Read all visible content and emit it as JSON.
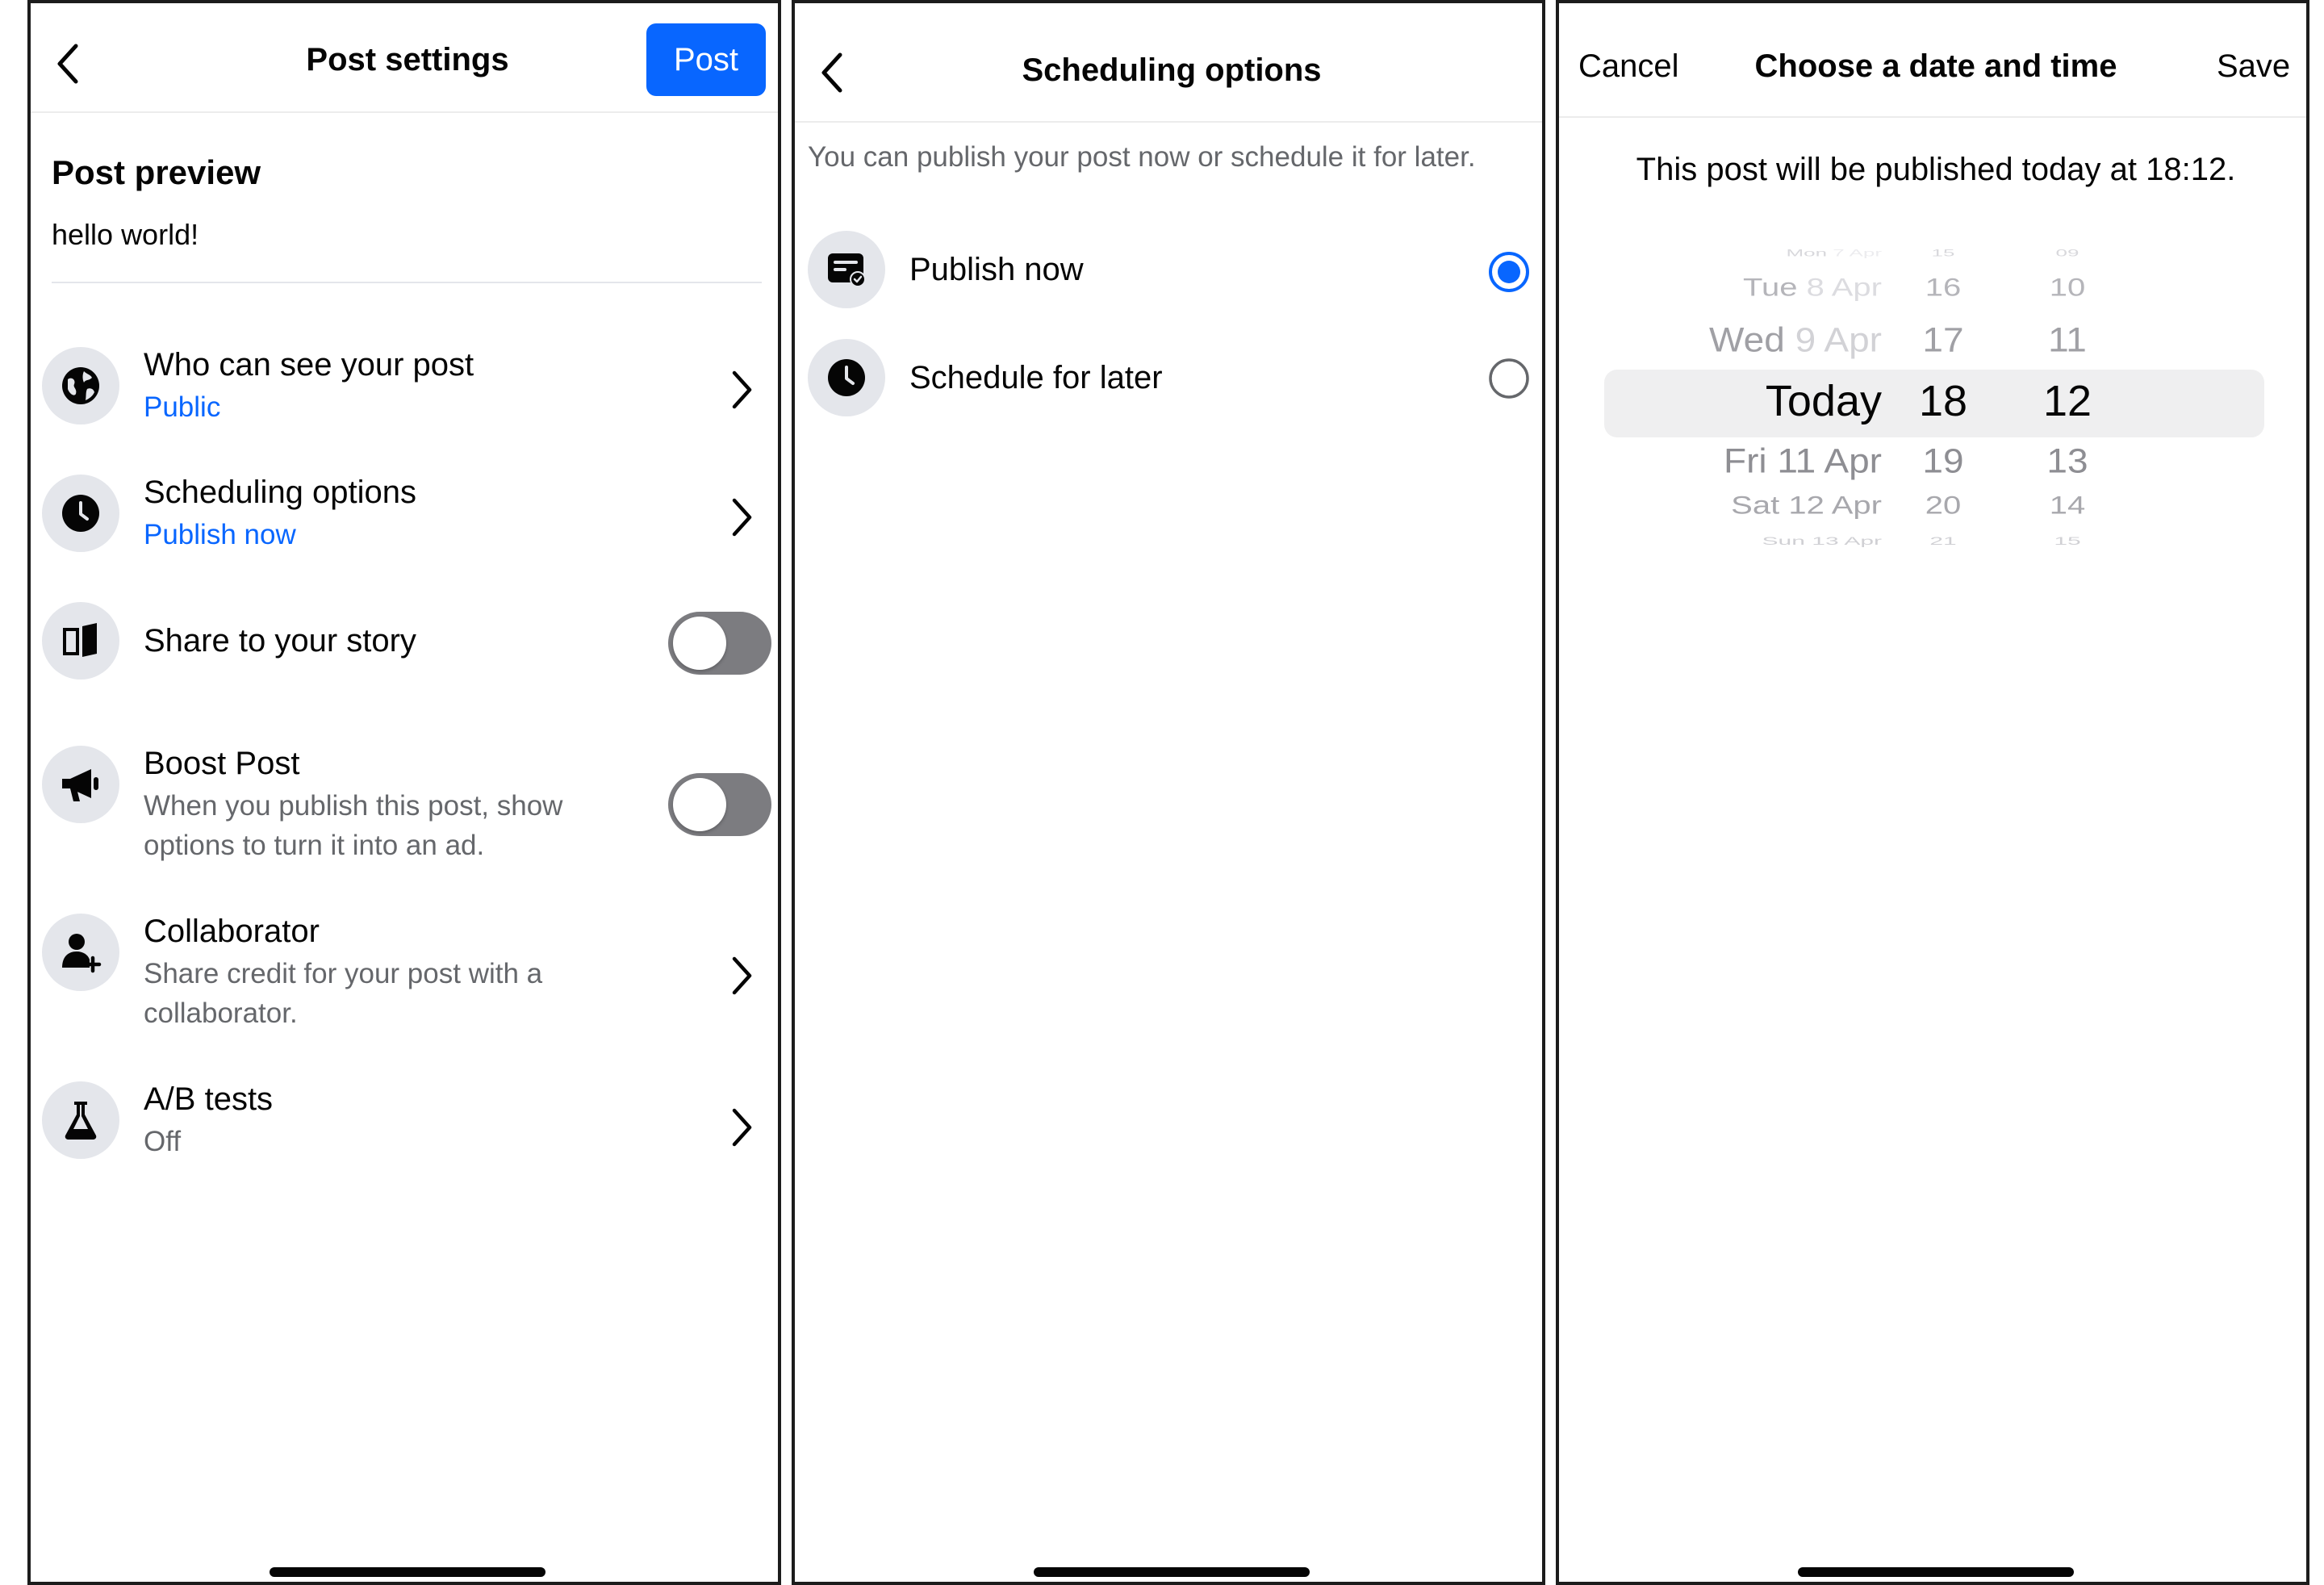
{
  "post_settings": {
    "title": "Post settings",
    "post_button": "Post",
    "preview_heading": "Post preview",
    "preview_text": "hello world!",
    "rows": [
      {
        "title": "Who can see your post",
        "subtitle": "Public",
        "icon": "globe-icon"
      },
      {
        "title": "Scheduling options",
        "subtitle": "Publish now",
        "icon": "clock-icon"
      },
      {
        "title": "Share to your story",
        "icon": "book-icon",
        "toggle": "off"
      },
      {
        "title": "Boost Post",
        "subtitle": "When you publish this post, show options to turn it into an ad.",
        "icon": "megaphone-icon",
        "toggle": "off"
      },
      {
        "title": "Collaborator",
        "subtitle": "Share credit for your post with a collaborator.",
        "icon": "add-person-icon"
      },
      {
        "title": "A/B tests",
        "subtitle": "Off",
        "icon": "flask-icon"
      }
    ]
  },
  "scheduling": {
    "title": "Scheduling options",
    "description": "You can publish your post now or schedule it for later.",
    "options": [
      {
        "label": "Publish now",
        "selected": true,
        "icon": "post-now-icon"
      },
      {
        "label": "Schedule for later",
        "selected": false,
        "icon": "clock-icon"
      }
    ]
  },
  "date_picker": {
    "cancel": "Cancel",
    "title": "Choose a date and time",
    "save": "Save",
    "message": "This post will be published today at 18:12.",
    "days": [
      {
        "weekday": "Mon",
        "date": "7 Apr"
      },
      {
        "weekday": "Tue",
        "date": "8 Apr"
      },
      {
        "weekday": "Wed",
        "date": "9 Apr"
      },
      {
        "weekday": "Today",
        "date": ""
      },
      {
        "weekday": "Fri",
        "date": "11 Apr"
      },
      {
        "weekday": "Sat",
        "date": "12 Apr"
      },
      {
        "weekday": "Sun",
        "date": "13 Apr"
      }
    ],
    "hours": [
      "15",
      "16",
      "17",
      "18",
      "19",
      "20",
      "21"
    ],
    "minutes": [
      "09",
      "10",
      "11",
      "12",
      "13",
      "14",
      "15"
    ],
    "selected": {
      "day": "Today",
      "hour": "18",
      "minute": "12"
    }
  },
  "colors": {
    "accent": "#0866ff",
    "toggle_off": "#7c7c80",
    "secondary_text": "#65676b",
    "icon_bg": "#e4e6eb"
  }
}
